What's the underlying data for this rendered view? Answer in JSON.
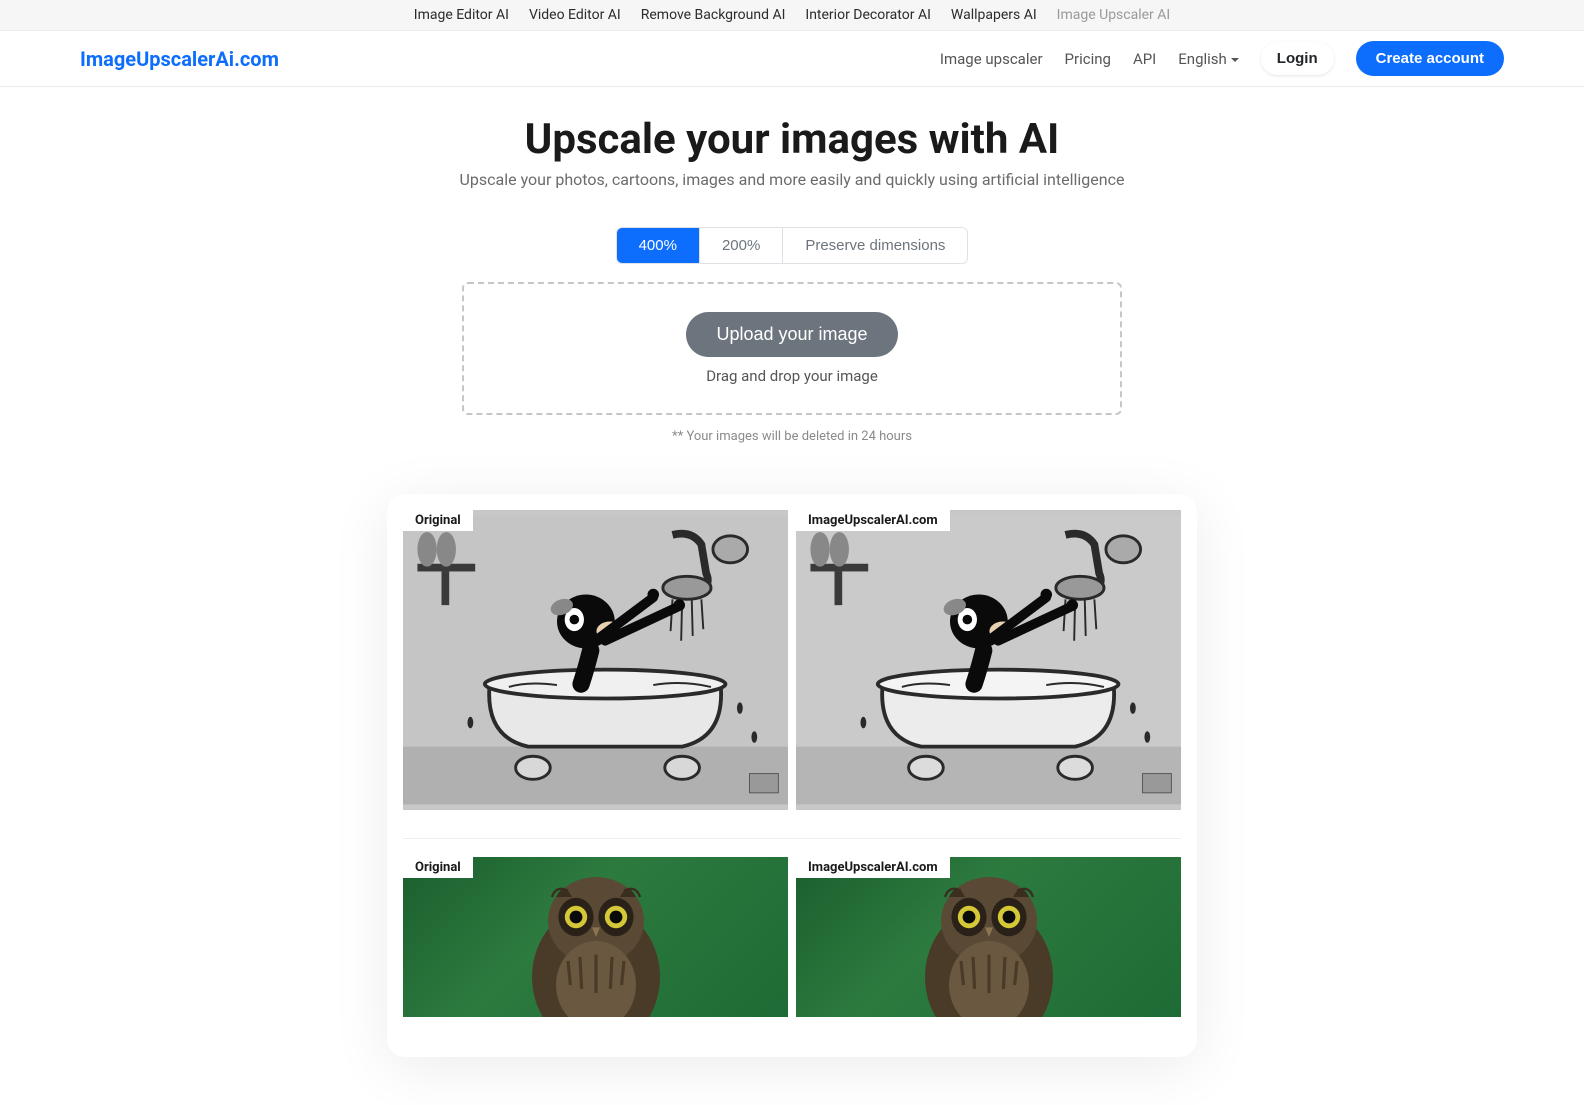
{
  "topBar": {
    "links": [
      {
        "label": "Image Editor AI",
        "current": false
      },
      {
        "label": "Video Editor AI",
        "current": false
      },
      {
        "label": "Remove Background AI",
        "current": false
      },
      {
        "label": "Interior Decorator AI",
        "current": false
      },
      {
        "label": "Wallpapers AI",
        "current": false
      },
      {
        "label": "Image Upscaler AI",
        "current": true
      }
    ]
  },
  "nav": {
    "logo": "ImageUpscalerAi.com",
    "links": {
      "upscaler": "Image upscaler",
      "pricing": "Pricing",
      "api": "API"
    },
    "language": "English",
    "login": "Login",
    "create": "Create account"
  },
  "hero": {
    "title": "Upscale your images with AI",
    "subtitle": "Upscale your photos, cartoons, images and more easily and quickly using artificial intelligence"
  },
  "scaleOptions": [
    {
      "label": "400%",
      "active": true
    },
    {
      "label": "200%",
      "active": false
    },
    {
      "label": "Preserve dimensions",
      "active": false
    }
  ],
  "upload": {
    "button": "Upload your image",
    "dropText": "Drag and drop your image",
    "note": "** Your images will be deleted in 24 hours"
  },
  "examples": {
    "labelOriginal": "Original",
    "labelUpscaled": "ImageUpscalerAI.com"
  }
}
